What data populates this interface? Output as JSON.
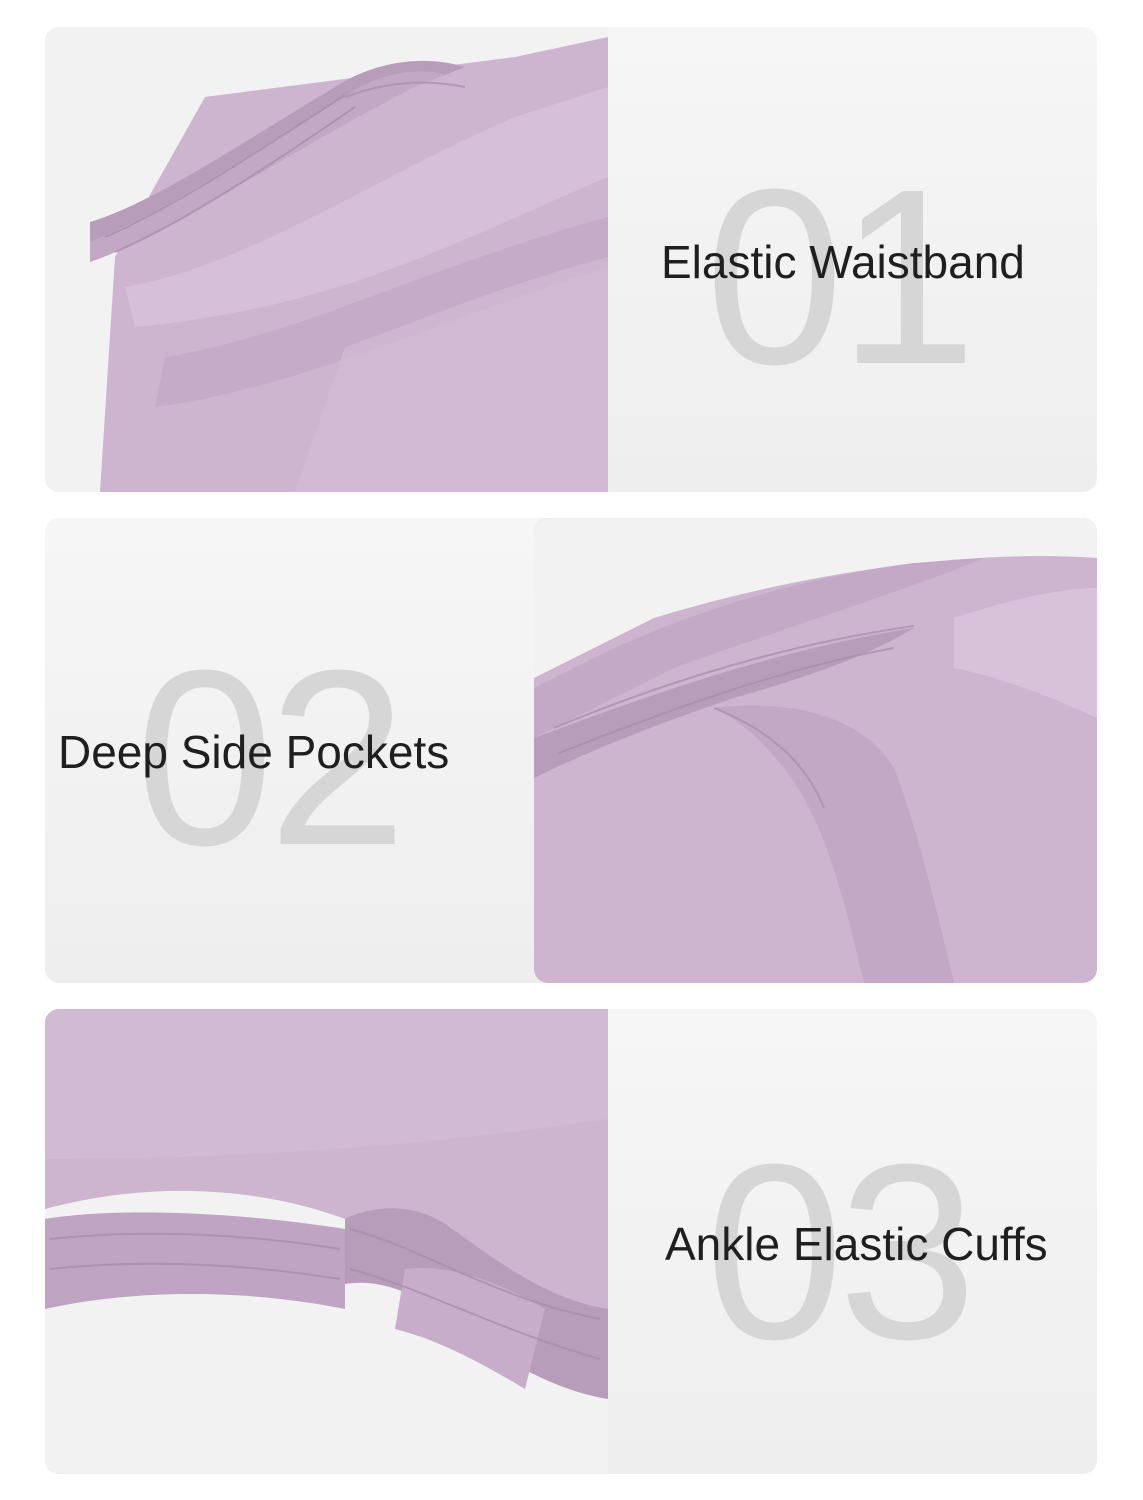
{
  "features": [
    {
      "number": "01",
      "label": "Elastic Waistband",
      "image": "waistband-closeup-photo"
    },
    {
      "number": "02",
      "label": "Deep Side Pockets",
      "image": "side-pocket-closeup-photo"
    },
    {
      "number": "03",
      "label": "Ankle Elastic Cuffs",
      "image": "ankle-cuff-closeup-photo"
    }
  ],
  "colors": {
    "fabric": "#cdb4cf",
    "fabric_shadow": "#b89dbb",
    "fabric_highlight": "#dcc6dd",
    "number_watermark": "#d6d6d6",
    "caption_text": "#1f1f1f",
    "panel_background": "#f2f2f2"
  }
}
